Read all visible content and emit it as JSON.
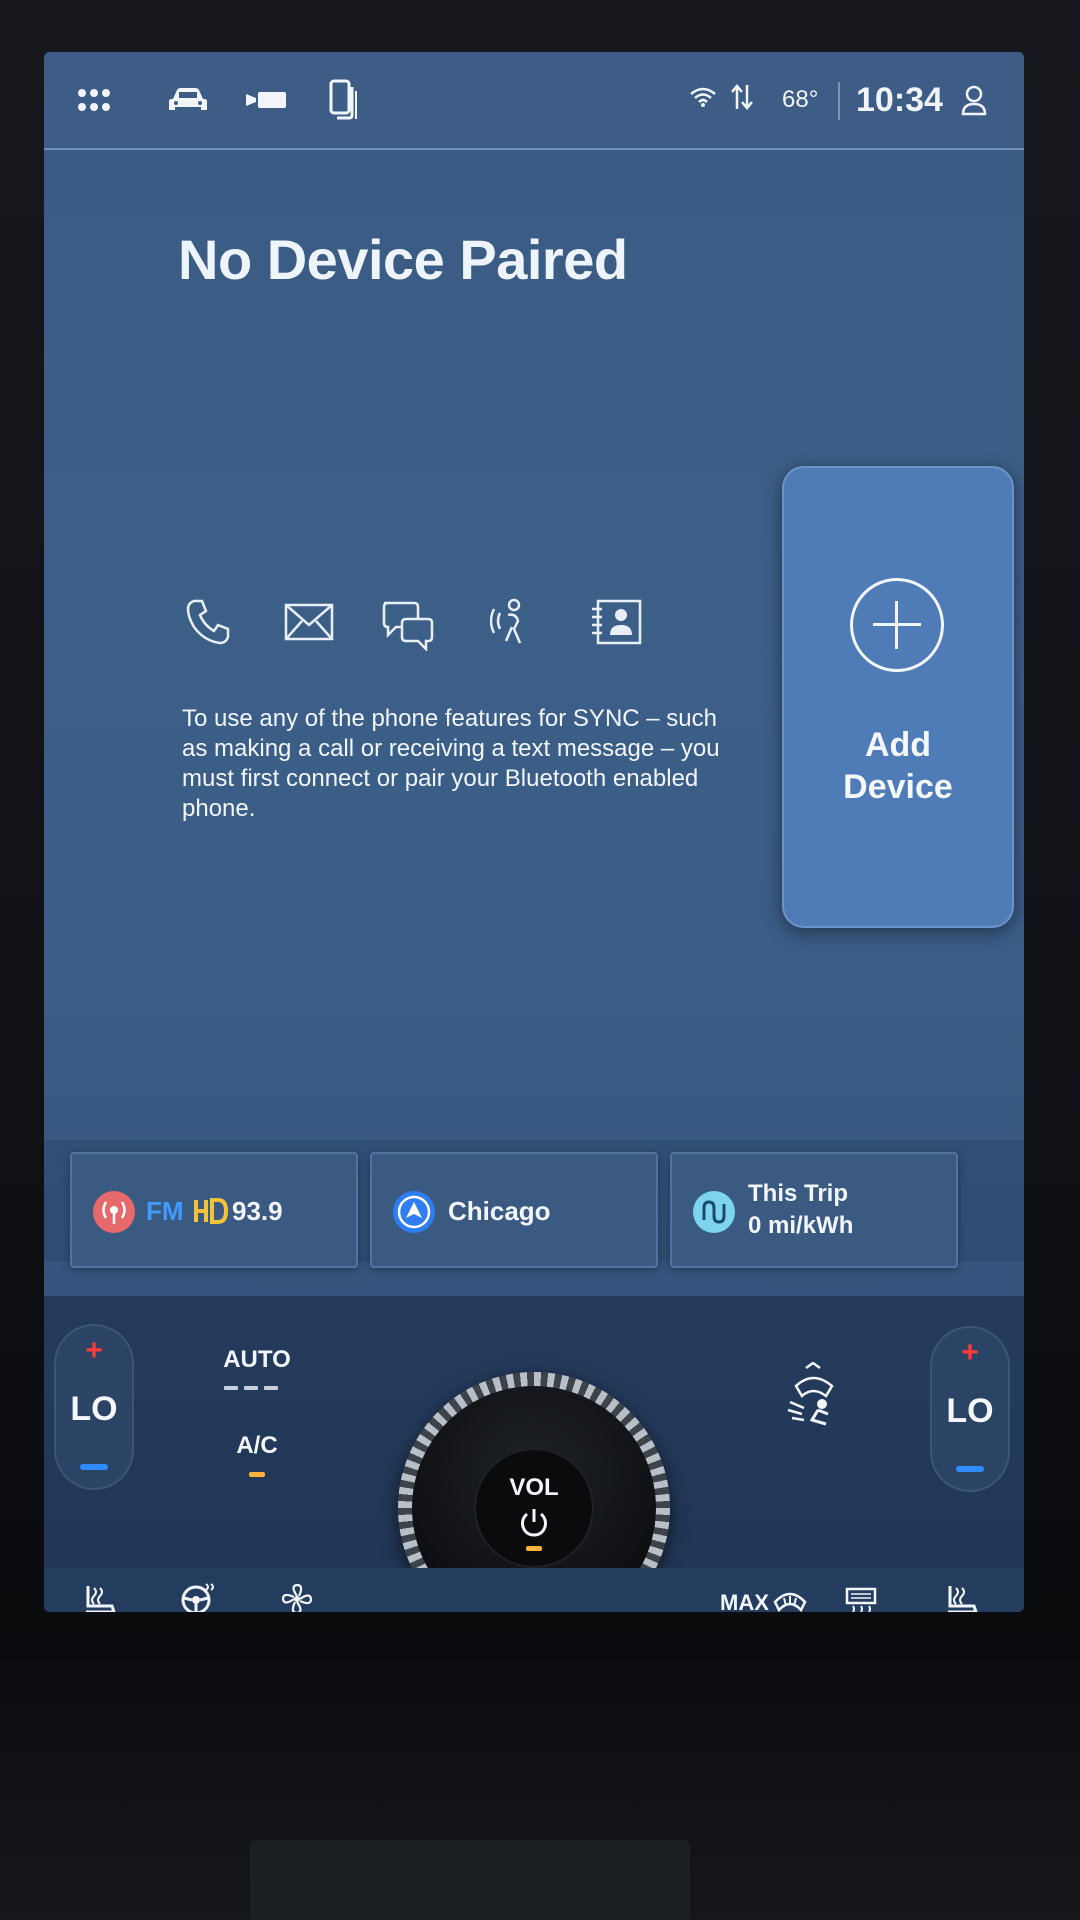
{
  "topbar": {
    "icons": [
      "apps-grid-icon",
      "vehicle-icon",
      "camera-icon",
      "phone-devices-icon"
    ],
    "status": {
      "wifi": "wifi-icon",
      "data": "data-arrows-icon",
      "temperature": "68°",
      "time": "10:34",
      "profile": "profile-icon"
    }
  },
  "main": {
    "title": "No Device Paired",
    "feature_icons": [
      "phone-icon",
      "message-icon",
      "chat-icon",
      "voice-icon",
      "contacts-icon"
    ],
    "description": "To use any of the phone features for SYNC – such as making a call or receiving a text message – you must first connect or pair your Bluetooth enabled phone.",
    "add_device": {
      "line1": "Add",
      "line2": "Device"
    }
  },
  "widgets": {
    "radio": {
      "band": "FM",
      "station": "93.9"
    },
    "nav": {
      "label": "Chicago"
    },
    "trip": {
      "title": "This Trip",
      "value": "0 mi/kWh"
    }
  },
  "climate": {
    "left_temp": "LO",
    "right_temp": "LO",
    "auto_label": "AUTO",
    "ac_label": "A/C",
    "knob_label": "VOL",
    "max_defrost_label": "MAX",
    "colors": {
      "accent_orange": "#ffb13b",
      "heat_red": "#ff3a3a",
      "cool_blue": "#2f8cff"
    }
  }
}
